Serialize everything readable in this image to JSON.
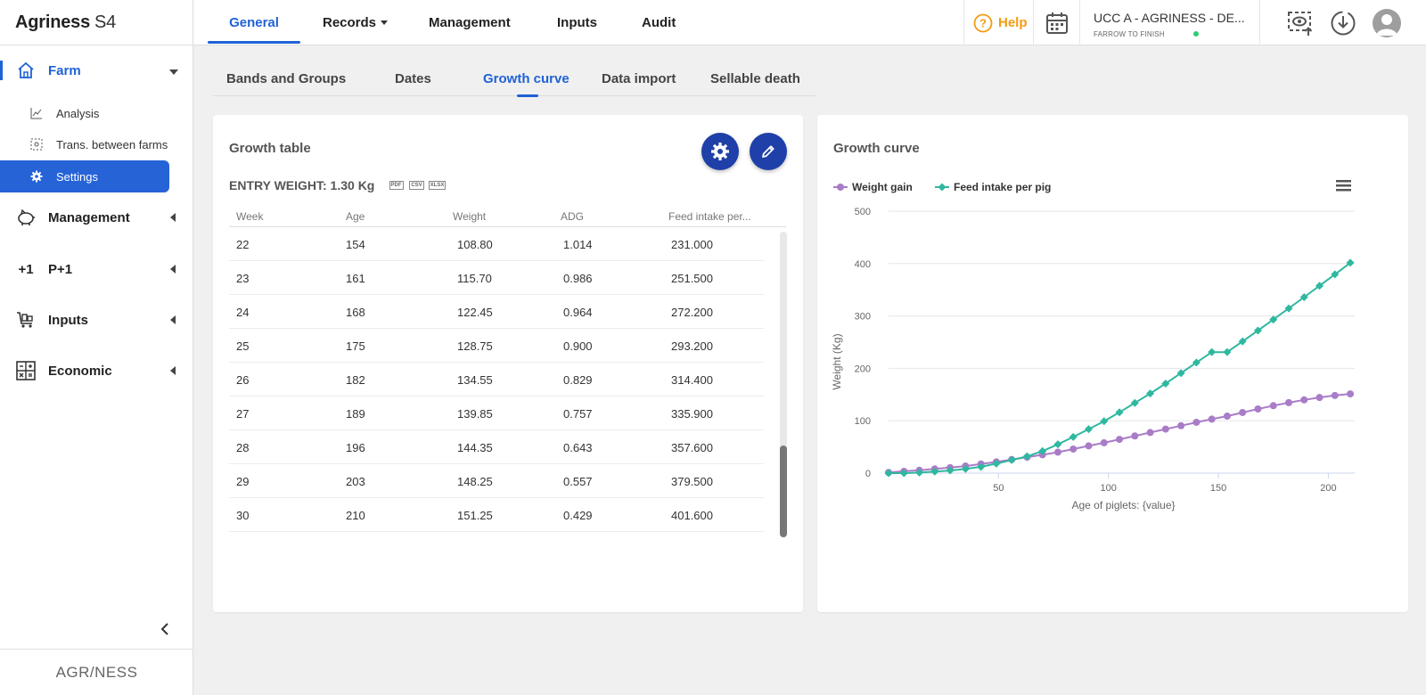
{
  "app": {
    "brand": "Agriness",
    "version": "S4",
    "footer_logo": "AGR/NESS"
  },
  "sidebar": {
    "farm": {
      "label": "Farm",
      "icon": "home-icon"
    },
    "farm_items": [
      {
        "label": "Analysis",
        "icon": "line-chart-icon"
      },
      {
        "label": "Trans. between farms",
        "icon": "transfer-icon"
      },
      {
        "label": "Settings",
        "icon": "gear-icon",
        "active": true
      }
    ],
    "sections": [
      {
        "label": "Management",
        "icon": "piggy-icon"
      },
      {
        "label": "P+1",
        "icon": "plus-one-icon"
      },
      {
        "label": "Inputs",
        "icon": "cart-icon"
      },
      {
        "label": "Economic",
        "icon": "calculator-icon"
      }
    ],
    "collapse_icon": "chevron-left-icon"
  },
  "topbar": {
    "tabs": [
      "General",
      "Records",
      "Management",
      "Inputs",
      "Audit"
    ],
    "active_tab": "General",
    "help_label": "Help",
    "farm_name": "UCC A - AGRINESS - DE...",
    "farm_type": "FARROW TO FINISH"
  },
  "subtabs": [
    "Bands and Groups",
    "Dates",
    "Growth curve",
    "Data import",
    "Sellable death"
  ],
  "active_subtab": "Growth curve",
  "growth_table": {
    "title": "Growth table",
    "entry_weight": "ENTRY WEIGHT: 1.30 Kg",
    "export_formats": [
      "PDF",
      "CSV",
      "XLSX"
    ],
    "columns": [
      "Week",
      "Age",
      "Weight",
      "ADG",
      "Feed intake per..."
    ],
    "rows": [
      [
        "22",
        "154",
        "108.80",
        "1.014",
        "231.000"
      ],
      [
        "23",
        "161",
        "115.70",
        "0.986",
        "251.500"
      ],
      [
        "24",
        "168",
        "122.45",
        "0.964",
        "272.200"
      ],
      [
        "25",
        "175",
        "128.75",
        "0.900",
        "293.200"
      ],
      [
        "26",
        "182",
        "134.55",
        "0.829",
        "314.400"
      ],
      [
        "27",
        "189",
        "139.85",
        "0.757",
        "335.900"
      ],
      [
        "28",
        "196",
        "144.35",
        "0.643",
        "357.600"
      ],
      [
        "29",
        "203",
        "148.25",
        "0.557",
        "379.500"
      ],
      [
        "30",
        "210",
        "151.25",
        "0.429",
        "401.600"
      ]
    ]
  },
  "growth_chart": {
    "title": "Growth curve",
    "menu_icon": "hamburger-menu-icon"
  },
  "chart_data": {
    "type": "line",
    "xlabel": "Age of piglets: {value}",
    "ylabel": "Weight (Kg)",
    "xlim": [
      0,
      212
    ],
    "ylim": [
      0,
      500
    ],
    "xticks": [
      50,
      100,
      150,
      200
    ],
    "yticks": [
      0,
      100,
      200,
      300,
      400,
      500
    ],
    "grid": true,
    "legend": "top-left",
    "x": [
      0,
      7,
      14,
      21,
      28,
      35,
      42,
      49,
      56,
      63,
      70,
      77,
      84,
      91,
      98,
      105,
      112,
      119,
      126,
      133,
      140,
      147,
      154,
      161,
      168,
      175,
      182,
      189,
      196,
      203,
      210
    ],
    "series": [
      {
        "name": "Weight gain",
        "color": "#a97cc8",
        "values": [
          1.3,
          3.5,
          5.5,
          8.0,
          10.5,
          13.5,
          17.5,
          21.5,
          26,
          30.5,
          35,
          40,
          46,
          52,
          58,
          64.5,
          71,
          77.5,
          84,
          90.5,
          97,
          103,
          108.8,
          115.7,
          122.45,
          128.75,
          134.55,
          139.85,
          144.35,
          148.25,
          151.25
        ]
      },
      {
        "name": "Feed intake per pig",
        "color": "#2fb8a0",
        "values": [
          0,
          0,
          1,
          3,
          5,
          8,
          12,
          18,
          25,
          32,
          42,
          55,
          69,
          84,
          99,
          116,
          134,
          152,
          171,
          191,
          211,
          231,
          231,
          251.5,
          272.2,
          293.2,
          314.4,
          335.9,
          357.6,
          379.5,
          401.6
        ]
      }
    ]
  }
}
